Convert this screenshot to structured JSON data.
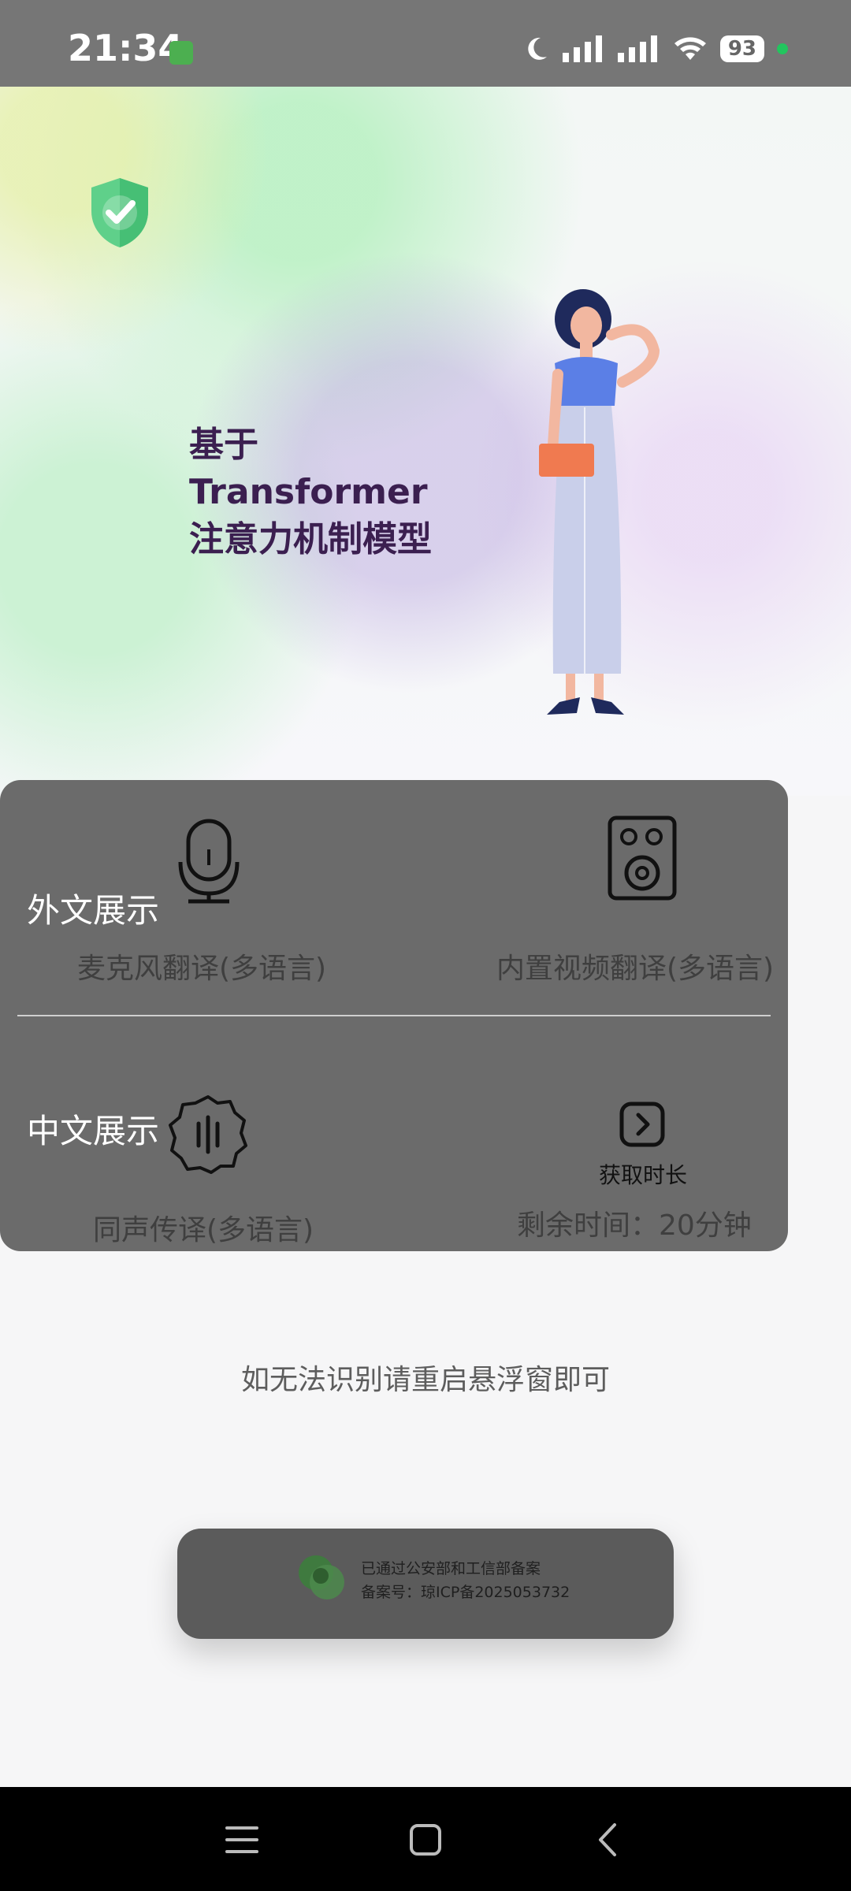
{
  "status_bar": {
    "time": "21:34",
    "battery": "93",
    "icons": [
      "app-notification-icon",
      "moon-icon",
      "signal-icon",
      "signal-icon",
      "wifi-icon",
      "battery-icon"
    ],
    "dot_color": "#22c55e"
  },
  "hero": {
    "headline_line1": "基于",
    "headline_line2": "Transformer",
    "headline_line3": "注意力机制模型",
    "icon": "shield-check-icon"
  },
  "panel": {
    "foreign_label": "外文展示",
    "chinese_label": "中文展示",
    "mic_caption": "麦克风翻译(多语言)",
    "video_caption": "内置视频翻译(多语言)",
    "simul_caption": "同声传译(多语言)",
    "get_time_label": "获取时长",
    "remaining_time": "剩余时间：20分钟"
  },
  "hint": "如无法识别请重启悬浮窗即可",
  "badge": {
    "line1": "已通过公安部和工信部备案",
    "line2": "备案号：琼ICP备2025053732"
  },
  "nav": {
    "icons": [
      "menu-icon",
      "home-icon",
      "back-icon"
    ]
  }
}
